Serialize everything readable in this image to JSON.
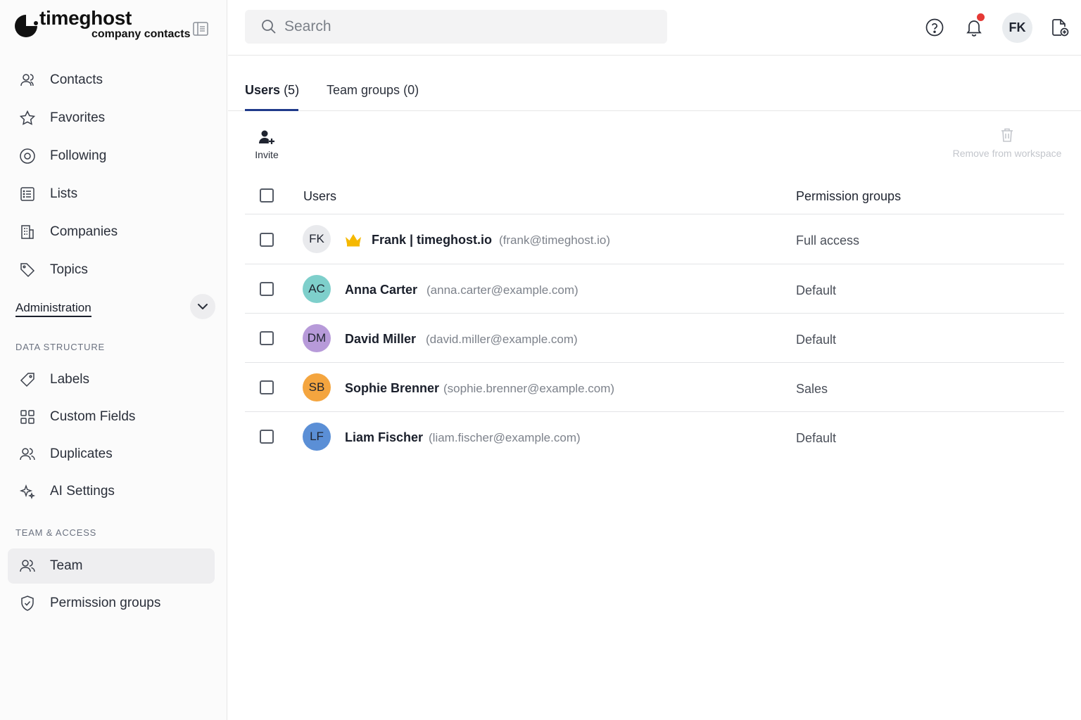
{
  "brand": {
    "name": "timeghost",
    "subtitle": "company contacts"
  },
  "sidebar": {
    "items": [
      {
        "label": "Contacts",
        "icon": "user-icon"
      },
      {
        "label": "Favorites",
        "icon": "star-icon"
      },
      {
        "label": "Following",
        "icon": "target-icon"
      },
      {
        "label": "Lists",
        "icon": "list-icon"
      },
      {
        "label": "Companies",
        "icon": "building-icon"
      },
      {
        "label": "Topics",
        "icon": "tag-icon"
      }
    ],
    "admin_label": "Administration",
    "section_data": "DATA STRUCTURE",
    "data_items": [
      {
        "label": "Labels",
        "icon": "label-icon"
      },
      {
        "label": "Custom Fields",
        "icon": "grid-icon"
      },
      {
        "label": "Duplicates",
        "icon": "users-icon"
      },
      {
        "label": "AI Settings",
        "icon": "sparkles-icon"
      }
    ],
    "section_team": "TEAM & ACCESS",
    "team_items": [
      {
        "label": "Team",
        "icon": "users-icon",
        "active": true
      },
      {
        "label": "Permission groups",
        "icon": "shield-icon"
      }
    ]
  },
  "search": {
    "placeholder": "Search",
    "value": ""
  },
  "header": {
    "avatar_initials": "FK"
  },
  "tabs": [
    {
      "label": "Users",
      "count": "(5)"
    },
    {
      "label": "Team groups",
      "count": "(0)"
    }
  ],
  "toolbar": {
    "invite_label": "Invite",
    "remove_label": "Remove from workspace"
  },
  "table": {
    "col_users": "Users",
    "col_permissions": "Permission groups",
    "rows": [
      {
        "initials": "FK",
        "name": "Frank | timeghost.io",
        "email": "(frank@timeghost.io)",
        "permission": "Full access",
        "avatar_color": "#e9eaed",
        "owner": true
      },
      {
        "initials": "AC",
        "name": "Anna Carter",
        "email": "(anna.carter@example.com)",
        "permission": "Default",
        "avatar_color": "#7ecfcb"
      },
      {
        "initials": "DM",
        "name": "David Miller",
        "email": "(david.miller@example.com)",
        "permission": "Default",
        "avatar_color": "#b79ad9"
      },
      {
        "initials": "SB",
        "name": "Sophie Brenner",
        "email": "(sophie.brenner@example.com)",
        "permission": "Sales",
        "avatar_color": "#f4a53f"
      },
      {
        "initials": "LF",
        "name": "Liam Fischer",
        "email": "(liam.fischer@example.com)",
        "permission": "Default",
        "avatar_color": "#5b8fd6"
      }
    ]
  }
}
